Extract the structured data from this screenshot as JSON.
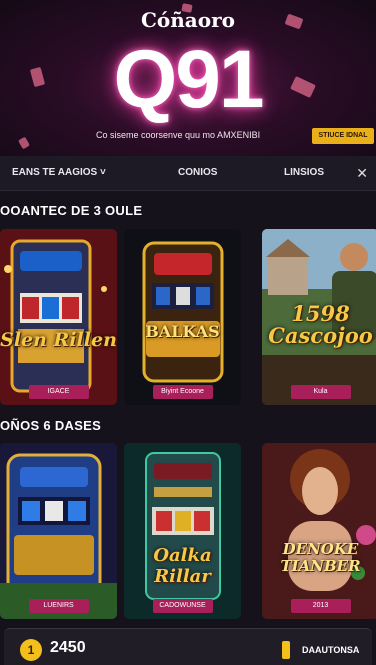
{
  "hero": {
    "brand": "Cóñaoro",
    "logo": "Q91",
    "tagline": "Co siseme coorsenve quu mo AMXENIBI",
    "cta_label": "STIUCE IDNAL"
  },
  "nav": {
    "items": [
      {
        "label": "EANS TE AAGIOS ˅"
      },
      {
        "label": "CONIOS"
      },
      {
        "label": "LINSIOS"
      }
    ],
    "close_glyph": "✕"
  },
  "sections": [
    {
      "title": "OOANTEC DE 3 OULE",
      "cards": [
        {
          "art_text": "Slen Rillen",
          "button": "IGACE",
          "theme": "red"
        },
        {
          "art_text": "BALKAS",
          "button": "Biyint Ecoone",
          "theme": "gold"
        },
        {
          "art_text": "1598 Cascojoo",
          "button": "Kula",
          "theme": "green"
        }
      ]
    },
    {
      "title": "OÑOS 6 DASES",
      "cards": [
        {
          "art_text": "",
          "button": "LUENIRS",
          "theme": "blue"
        },
        {
          "art_text": "Oalka Rillar",
          "button": "CADOWUNSE",
          "theme": "teal"
        },
        {
          "art_text": "DENOKE TIANBER",
          "button": "2013",
          "theme": "rose"
        }
      ]
    }
  ],
  "bottom_bar": {
    "coin_glyph": "1",
    "balance": "2450",
    "label": "DAAUTONSA"
  },
  "colors": {
    "accent": "#a81f5a",
    "gold": "#e9b01a",
    "background": "#15121c"
  }
}
